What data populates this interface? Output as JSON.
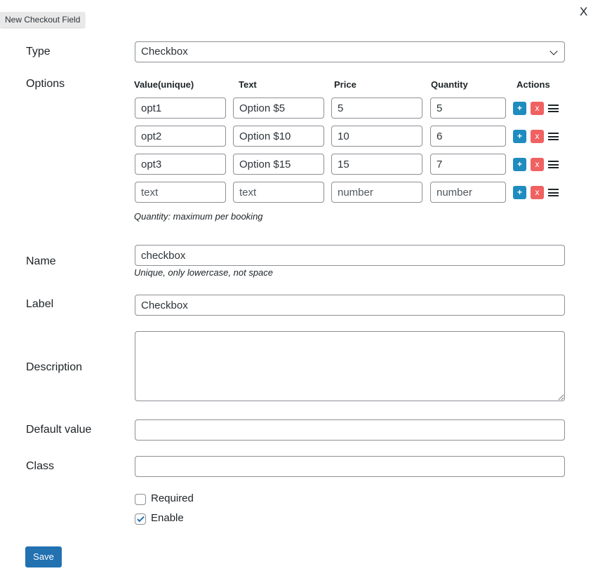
{
  "tooltip": {
    "text": "New Checkout Field"
  },
  "close": {
    "label": "X"
  },
  "type_row": {
    "label": "Type",
    "value": "Checkbox"
  },
  "options_row": {
    "label": "Options",
    "headers": [
      "Value(unique)",
      "Text",
      "Price",
      "Quantity",
      "Actions"
    ],
    "rows": [
      {
        "value": "opt1",
        "text": "Option $5",
        "price": "5",
        "quantity": "5"
      },
      {
        "value": "opt2",
        "text": "Option $10",
        "price": "10",
        "quantity": "6"
      },
      {
        "value": "opt3",
        "text": "Option $15",
        "price": "15",
        "quantity": "7"
      },
      {
        "value": "",
        "text": "",
        "price": "",
        "quantity": ""
      }
    ],
    "placeholders": {
      "value": "text",
      "text": "text",
      "price": "number",
      "quantity": "number"
    },
    "add_label": "+",
    "delete_label": "x",
    "add_color": "#1e8cbe",
    "delete_color": "#f06161",
    "drag_icon": "hamburger-drag-icon",
    "help": "Quantity: maximum per booking"
  },
  "name_row": {
    "label": "Name",
    "value": "checkbox",
    "help": "Unique, only lowercase, not space"
  },
  "label_row": {
    "label": "Label",
    "value": "Checkbox"
  },
  "description_row": {
    "label": "Description",
    "value": ""
  },
  "default_row": {
    "label": "Default value",
    "value": ""
  },
  "class_row": {
    "label": "Class",
    "value": ""
  },
  "required": {
    "label": "Required",
    "checked": false
  },
  "enable": {
    "label": "Enable",
    "checked": true
  },
  "save": {
    "label": "Save",
    "color": "#2271b1"
  }
}
